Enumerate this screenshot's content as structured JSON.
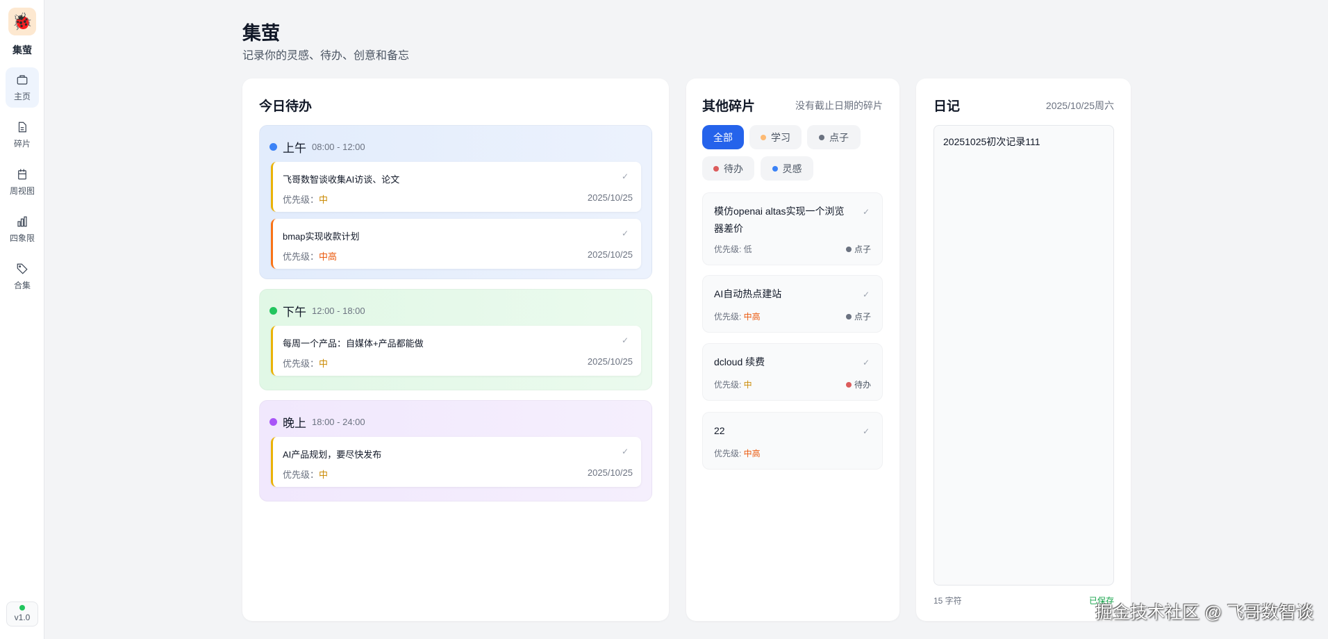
{
  "sidebar": {
    "brand": "集萤",
    "items": [
      {
        "label": "主页",
        "icon": "briefcase-icon"
      },
      {
        "label": "碎片",
        "icon": "file-icon"
      },
      {
        "label": "周视图",
        "icon": "calendar-icon"
      },
      {
        "label": "四象限",
        "icon": "bar-chart-icon"
      },
      {
        "label": "合集",
        "icon": "tag-icon"
      }
    ],
    "version": "v1.0"
  },
  "header": {
    "title": "集萤",
    "subtitle": "记录你的灵感、待办、创意和备忘"
  },
  "today": {
    "title": "今日待办",
    "sections": [
      {
        "name": "上午",
        "time": "08:00 - 12:00",
        "color": "#3b82f6",
        "tasks": [
          {
            "title": "飞哥数智谈收集AI访谈、论文",
            "priority_label": "优先级：",
            "priority": "中",
            "date": "2025/10/25"
          },
          {
            "title": "bmap实现收款计划",
            "priority_label": "优先级：",
            "priority": "中高",
            "date": "2025/10/25"
          }
        ]
      },
      {
        "name": "下午",
        "time": "12:00 - 18:00",
        "color": "#22c55e",
        "tasks": [
          {
            "title": "每周一个产品：自媒体+产品都能做",
            "priority_label": "优先级：",
            "priority": "中",
            "date": "2025/10/25"
          }
        ]
      },
      {
        "name": "晚上",
        "time": "18:00 - 24:00",
        "color": "#a855f7",
        "tasks": [
          {
            "title": "AI产品规划，要尽快发布",
            "priority_label": "优先级：",
            "priority": "中",
            "date": "2025/10/25"
          }
        ]
      }
    ]
  },
  "fragments": {
    "title": "其他碎片",
    "meta": "没有截止日期的碎片",
    "filters": [
      {
        "label": "全部",
        "active": true
      },
      {
        "label": "学习",
        "color": "#fdba74"
      },
      {
        "label": "点子",
        "color": "#6b7280"
      },
      {
        "label": "待办",
        "color": "#ef4444"
      },
      {
        "label": "灵感",
        "color": "#3b82f6"
      }
    ],
    "items": [
      {
        "title": "模仿openai altas实现一个浏览器差价",
        "priority_label": "优先级: ",
        "priority": "低",
        "tag": "点子"
      },
      {
        "title": "AI自动热点建站",
        "priority_label": "优先级: ",
        "priority": "中高",
        "tag": "点子"
      },
      {
        "title": "dcloud 续费",
        "priority_label": "优先级: ",
        "priority": "中",
        "tag": "待办"
      },
      {
        "title": "22",
        "priority_label": "优先级: ",
        "priority": "中高"
      }
    ]
  },
  "diary": {
    "title": "日记",
    "date": "2025/10/25周六",
    "content": "20251025初次记录111",
    "char_count": "15 字符",
    "status": "已保存"
  },
  "watermark": "掘金技术社区 @ 飞哥数智谈",
  "colors": {
    "accent": "#2563eb",
    "mid": "#ca8a04",
    "midhigh": "#ea580c",
    "saved": "#16a34a"
  }
}
